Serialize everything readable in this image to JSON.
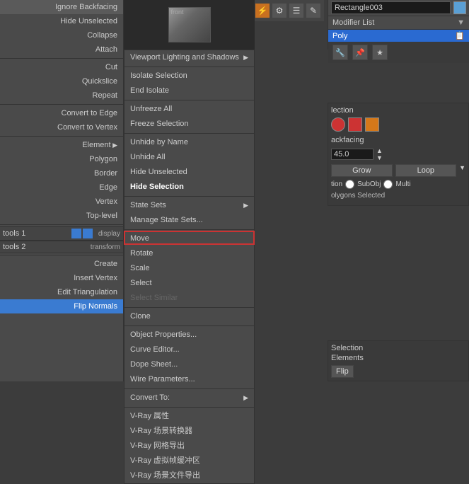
{
  "left_menu": {
    "items": [
      {
        "label": "Ignore Backfacing",
        "type": "normal"
      },
      {
        "label": "Hide Unselected",
        "type": "normal"
      },
      {
        "label": "Collapse",
        "type": "normal"
      },
      {
        "label": "Attach",
        "type": "normal"
      },
      {
        "label": "Cut",
        "type": "normal"
      },
      {
        "label": "Quickslice",
        "type": "normal"
      },
      {
        "label": "Repeat",
        "type": "normal"
      },
      {
        "label": "Convert to Edge",
        "type": "normal"
      },
      {
        "label": "Convert to Vertex",
        "type": "normal"
      },
      {
        "label": "Element",
        "type": "arrow"
      },
      {
        "label": "Polygon",
        "type": "normal"
      },
      {
        "label": "Border",
        "type": "normal"
      },
      {
        "label": "Edge",
        "type": "normal"
      },
      {
        "label": "Vertex",
        "type": "normal"
      },
      {
        "label": "Top-level",
        "type": "normal"
      }
    ],
    "tools1_label": "tools 1",
    "tools2_label": "tools 2",
    "display_label": "display",
    "transform_label": "transform",
    "bottom_items": [
      {
        "label": "Create",
        "type": "normal"
      },
      {
        "label": "Insert Vertex",
        "type": "normal"
      },
      {
        "label": "Edit Triangulation",
        "type": "normal"
      },
      {
        "label": "Flip Normals",
        "type": "highlighted"
      }
    ]
  },
  "main_menu": {
    "items": [
      {
        "label": "Viewport Lighting and Shadows",
        "type": "arrow"
      },
      {
        "label": "Isolate Selection",
        "type": "normal"
      },
      {
        "label": "End Isolate",
        "type": "normal"
      },
      {
        "label": "Unfreeze All",
        "type": "normal"
      },
      {
        "label": "Freeze Selection",
        "type": "normal"
      },
      {
        "label": "Unhide by Name",
        "type": "normal"
      },
      {
        "label": "Unhide All",
        "type": "normal"
      },
      {
        "label": "Hide Unselected",
        "type": "normal"
      },
      {
        "label": "Hide Selection",
        "type": "bold"
      },
      {
        "label": "State Sets",
        "type": "arrow"
      },
      {
        "label": "Manage State Sets...",
        "type": "normal"
      },
      {
        "label": "Move",
        "type": "normal"
      },
      {
        "label": "Rotate",
        "type": "normal"
      },
      {
        "label": "Scale",
        "type": "normal"
      },
      {
        "label": "Select",
        "type": "normal"
      },
      {
        "label": "Select Similar",
        "type": "grayed"
      },
      {
        "label": "Clone",
        "type": "normal"
      },
      {
        "label": "Object Properties...",
        "type": "normal"
      },
      {
        "label": "Curve Editor...",
        "type": "normal"
      },
      {
        "label": "Dope Sheet...",
        "type": "normal"
      },
      {
        "label": "Wire Parameters...",
        "type": "normal"
      },
      {
        "label": "Convert To:",
        "type": "arrow"
      },
      {
        "label": "V-Ray 属性",
        "type": "normal"
      },
      {
        "label": "V-Ray 场景转换器",
        "type": "normal"
      },
      {
        "label": "V-Ray 网格导出",
        "type": "normal"
      },
      {
        "label": "V-Ray 虚拟帧缓冲区",
        "type": "normal"
      },
      {
        "label": "V-Ray 场景文件导出",
        "type": "normal"
      }
    ]
  },
  "right_panel": {
    "object_name": "Rectangle003",
    "modifier_list": "Modifier List",
    "poly_label": "Poly",
    "selection_title": "lection",
    "backfacing_label": "ackfacing",
    "angle_value": "45.0",
    "grow_label": "Grow",
    "loop_label": "Loop",
    "tion_label": "tion",
    "subobj_label": "SubObj",
    "multi_label": "Multi",
    "polygons_selected": "olygons Selected",
    "selection_label": "Selection",
    "elements_label": "Elements",
    "flip_label": "Flip"
  },
  "icons": {
    "dropdown_char": "▼",
    "arrow_right": "▶",
    "close_char": "✕"
  }
}
